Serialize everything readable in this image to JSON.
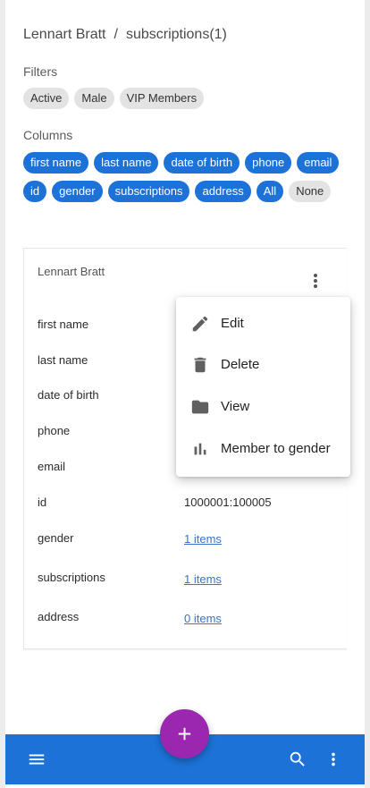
{
  "breadcrumb": {
    "parent": "Lennart Bratt",
    "separator": "/",
    "current": "subscriptions(1)"
  },
  "filters": {
    "label": "Filters",
    "chips": [
      "Active",
      "Male",
      "VIP Members"
    ]
  },
  "columns": {
    "label": "Columns",
    "chips": [
      "first name",
      "last name",
      "date of birth",
      "phone",
      "email",
      "id",
      "gender",
      "subscriptions",
      "address",
      "All",
      "None"
    ],
    "selected_color": "#1c72d6",
    "unselected_color": "#e3e3e3"
  },
  "card": {
    "title": "Lennart Bratt",
    "rows": [
      {
        "label": "first name",
        "value": ""
      },
      {
        "label": "last name",
        "value": ""
      },
      {
        "label": "date of birth",
        "value": ""
      },
      {
        "label": "phone",
        "value": ""
      },
      {
        "label": "email",
        "value": ""
      },
      {
        "label": "id",
        "value": "1000001:100005"
      },
      {
        "label": "gender",
        "value": "1 items"
      },
      {
        "label": "subscriptions",
        "value": "1 items"
      },
      {
        "label": "address",
        "value": "0 items"
      }
    ]
  },
  "menu": {
    "items": [
      {
        "label": "Edit",
        "icon": "pencil-icon"
      },
      {
        "label": "Delete",
        "icon": "trash-icon"
      },
      {
        "label": "View",
        "icon": "folder-icon"
      },
      {
        "label": "Member to gender",
        "icon": "bar-chart-icon"
      }
    ]
  },
  "appbar": {
    "color": "#1c72d6",
    "icons": [
      "hamburger-menu-icon",
      "search-icon",
      "more-vert-icon"
    ]
  },
  "fab": {
    "icon": "plus-icon",
    "color": "#9b27b0"
  }
}
